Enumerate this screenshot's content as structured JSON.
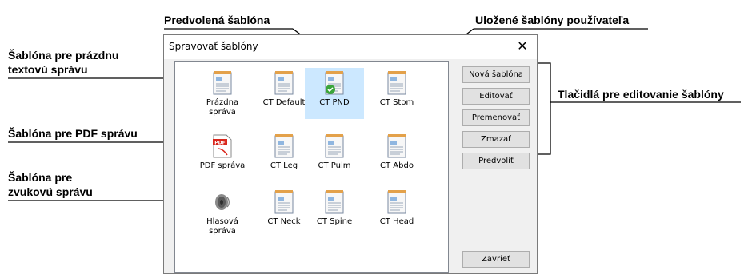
{
  "callouts": {
    "default_template": "Predvolená šablóna",
    "user_templates": "Uložené šablóny používateľa",
    "empty_template_line1": "Šablóna pre prázdnu",
    "empty_template_line2": "textovú správu",
    "pdf_template": "Šablóna pre PDF správu",
    "voice_template_line1": "Šablóna pre",
    "voice_template_line2": "zvukovú správu",
    "edit_buttons": "Tlačidlá pre editovanie šablóny"
  },
  "dialog": {
    "title": "Spravovať šablóny",
    "close_glyph": "✕"
  },
  "templates": [
    {
      "label": "Prázdna\nspráva",
      "icon": "document-icon"
    },
    {
      "label": "CT Default",
      "icon": "document-icon"
    },
    {
      "label": "CT PND",
      "icon": "document-default-icon",
      "selected": true
    },
    {
      "label": "CT Stom",
      "icon": "document-icon"
    },
    {
      "label": "PDF správa",
      "icon": "pdf-icon"
    },
    {
      "label": "CT Leg",
      "icon": "document-icon"
    },
    {
      "label": "CT Pulm",
      "icon": "document-icon"
    },
    {
      "label": "CT Abdo",
      "icon": "document-icon"
    },
    {
      "label": "Hlasová\nspráva",
      "icon": "speaker-icon"
    },
    {
      "label": "CT Neck",
      "icon": "document-icon"
    },
    {
      "label": "CT Spine",
      "icon": "document-icon"
    },
    {
      "label": "CT Head",
      "icon": "document-icon"
    }
  ],
  "buttons": {
    "new": "Nová šablóna",
    "edit": "Editovať",
    "rename": "Premenovať",
    "delete": "Zmazať",
    "set_default": "Predvoliť",
    "close": "Zavrieť"
  },
  "colors": {
    "selection": "#cce8ff",
    "check_green": "#3aa53a",
    "pdf_red": "#d9261c"
  }
}
